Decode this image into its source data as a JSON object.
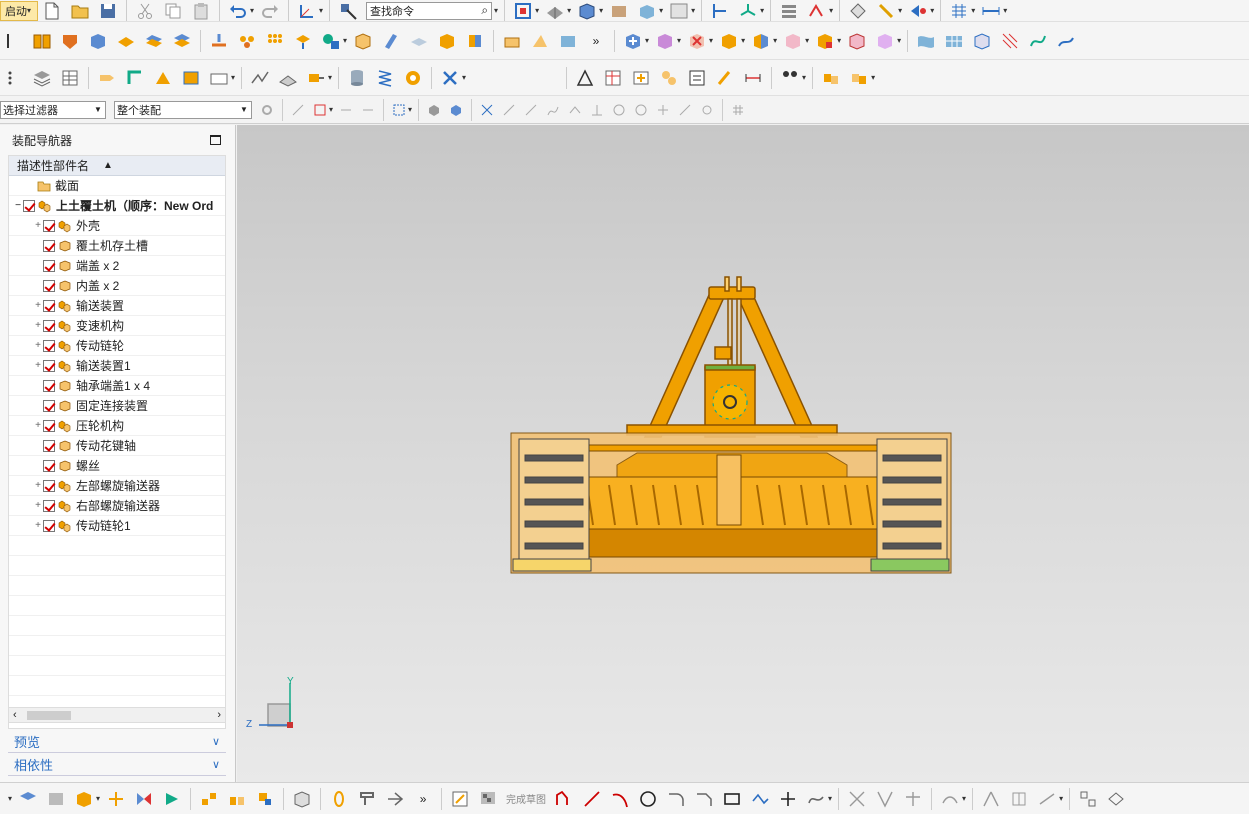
{
  "toolbar": {
    "start_label": "启动",
    "search_placeholder": "查找命令",
    "more_glyph": "»"
  },
  "filter_bar": {
    "selection_filter": "选择过滤器",
    "scope": "整个装配"
  },
  "navigator": {
    "title": "装配导航器",
    "column_header": "描述性部件名",
    "sort_indicator": "▲",
    "items": [
      {
        "label": "截面",
        "level": 1,
        "expander": "",
        "checked": false,
        "icon": "folder-icon"
      },
      {
        "label": "上土覆土机（顺序：New Ord",
        "level": 0,
        "expander": "−",
        "checked": true,
        "icon": "assembly-icon",
        "bold": true
      },
      {
        "label": "外壳",
        "level": 2,
        "expander": "+",
        "checked": true,
        "icon": "assembly-icon"
      },
      {
        "label": "覆土机存土槽",
        "level": 2,
        "expander": "",
        "checked": true,
        "icon": "part-icon"
      },
      {
        "label": "端盖 x 2",
        "level": 2,
        "expander": "",
        "checked": true,
        "icon": "part-icon"
      },
      {
        "label": "内盖 x 2",
        "level": 2,
        "expander": "",
        "checked": true,
        "icon": "part-icon"
      },
      {
        "label": "输送装置",
        "level": 2,
        "expander": "+",
        "checked": true,
        "icon": "assembly-icon"
      },
      {
        "label": "变速机构",
        "level": 2,
        "expander": "+",
        "checked": true,
        "icon": "assembly-icon"
      },
      {
        "label": "传动链轮",
        "level": 2,
        "expander": "+",
        "checked": true,
        "icon": "assembly-icon"
      },
      {
        "label": "输送装置1",
        "level": 2,
        "expander": "+",
        "checked": true,
        "icon": "assembly-icon"
      },
      {
        "label": "轴承端盖1 x 4",
        "level": 2,
        "expander": "",
        "checked": true,
        "icon": "part-icon"
      },
      {
        "label": "固定连接装置",
        "level": 2,
        "expander": "",
        "checked": true,
        "icon": "part-icon"
      },
      {
        "label": "压轮机构",
        "level": 2,
        "expander": "+",
        "checked": true,
        "icon": "assembly-icon"
      },
      {
        "label": "传动花键轴",
        "level": 2,
        "expander": "",
        "checked": true,
        "icon": "part-icon"
      },
      {
        "label": "螺丝",
        "level": 2,
        "expander": "",
        "checked": true,
        "icon": "part-icon"
      },
      {
        "label": "左部螺旋输送器",
        "level": 2,
        "expander": "+",
        "checked": true,
        "icon": "assembly-icon"
      },
      {
        "label": "右部螺旋输送器",
        "level": 2,
        "expander": "+",
        "checked": true,
        "icon": "assembly-icon"
      },
      {
        "label": "传动链轮1",
        "level": 2,
        "expander": "+",
        "checked": true,
        "icon": "assembly-icon"
      }
    ],
    "preview_label": "预览",
    "dependency_label": "相依性"
  },
  "viewport": {
    "axis_y": "Y",
    "axis_z": "Z"
  },
  "bottom_toolbar": {
    "finish_sketch": "完成草图",
    "more_glyph": "»"
  },
  "colors": {
    "accent": "#f0a000",
    "model_dark": "#c97700",
    "tree_check": "#d40000",
    "link_blue": "#2c6ec2"
  }
}
